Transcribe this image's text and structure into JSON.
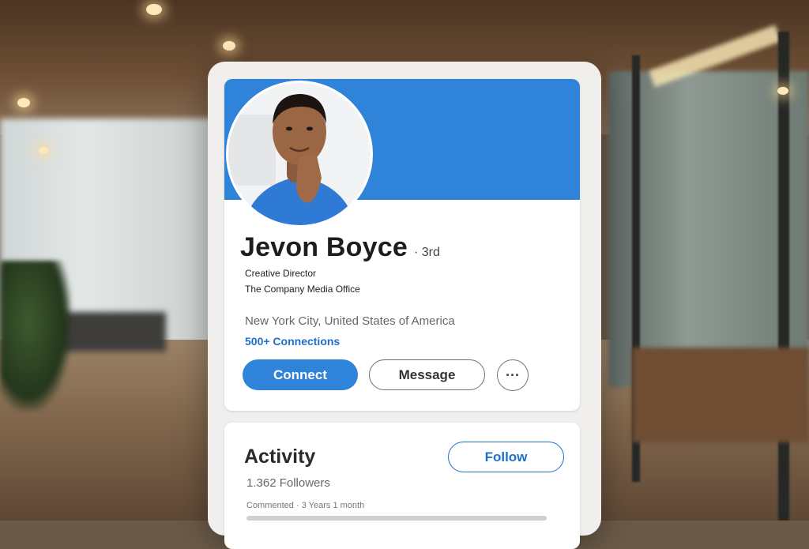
{
  "profile": {
    "name": "Jevon Boyce",
    "degree": "· 3rd",
    "headline": "Creative Director",
    "company": "The Company Media Office",
    "location": "New York City, United States of America",
    "connections": "500+ Connections",
    "banner_color": "#2f83d8"
  },
  "actions": {
    "connect_label": "Connect",
    "message_label": "Message",
    "more_label": "···"
  },
  "activity": {
    "title": "Activity",
    "followers": "1.362 Followers",
    "follow_label": "Follow",
    "commented": "Commented · 3 Years 1 month"
  },
  "colors": {
    "accent": "#2f83d8",
    "link": "#1f6fc9"
  }
}
